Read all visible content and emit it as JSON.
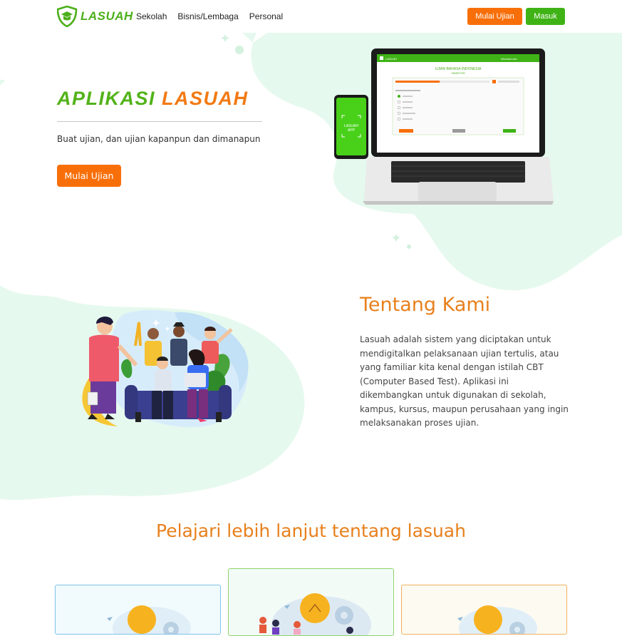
{
  "brand": {
    "name": "LASUAH",
    "colors": {
      "green": "#3fb316",
      "orange": "#f86f0a",
      "mint": "#e6f9ee"
    }
  },
  "nav": {
    "links": [
      "Sekolah",
      "Bisnis/Lembaga",
      "Personal"
    ],
    "start_exam": "Mulai Ujian",
    "login": "Masuk"
  },
  "hero": {
    "title_part1": "APLIKASI",
    "title_part2": "LASUAH",
    "subtitle": "Buat ujian, dan ujian kapanpun dan dimanapun",
    "cta": "Mulai Ujian",
    "laptop_screen_title": "UJIAN BAHASA INDONESIA",
    "laptop_screen_subtitle": "SEMESTER",
    "phone_text": "LASUAH APP"
  },
  "about": {
    "title": "Tentang Kami",
    "body": "Lasuah adalah sistem yang diciptakan untuk mendigitalkan pelaksanaan ujian tertulis, atau yang familiar kita kenal dengan istilah CBT (Computer Based Test). Aplikasi ini dikembangkan untuk digunakan di sekolah, kampus, kursus, maupun perusahaan yang ingin melaksanakan proses ujian."
  },
  "learn": {
    "title": "Pelajari lebih lanjut tentang lasuah",
    "cards": [
      {
        "name": "card-left",
        "border": "#7cc3e8",
        "bg": "#f1fafd"
      },
      {
        "name": "card-center",
        "border": "#8fd26a",
        "bg": "#f2fbf6"
      },
      {
        "name": "card-right",
        "border": "#f2b05e",
        "bg": "#fdfaf1"
      }
    ]
  }
}
